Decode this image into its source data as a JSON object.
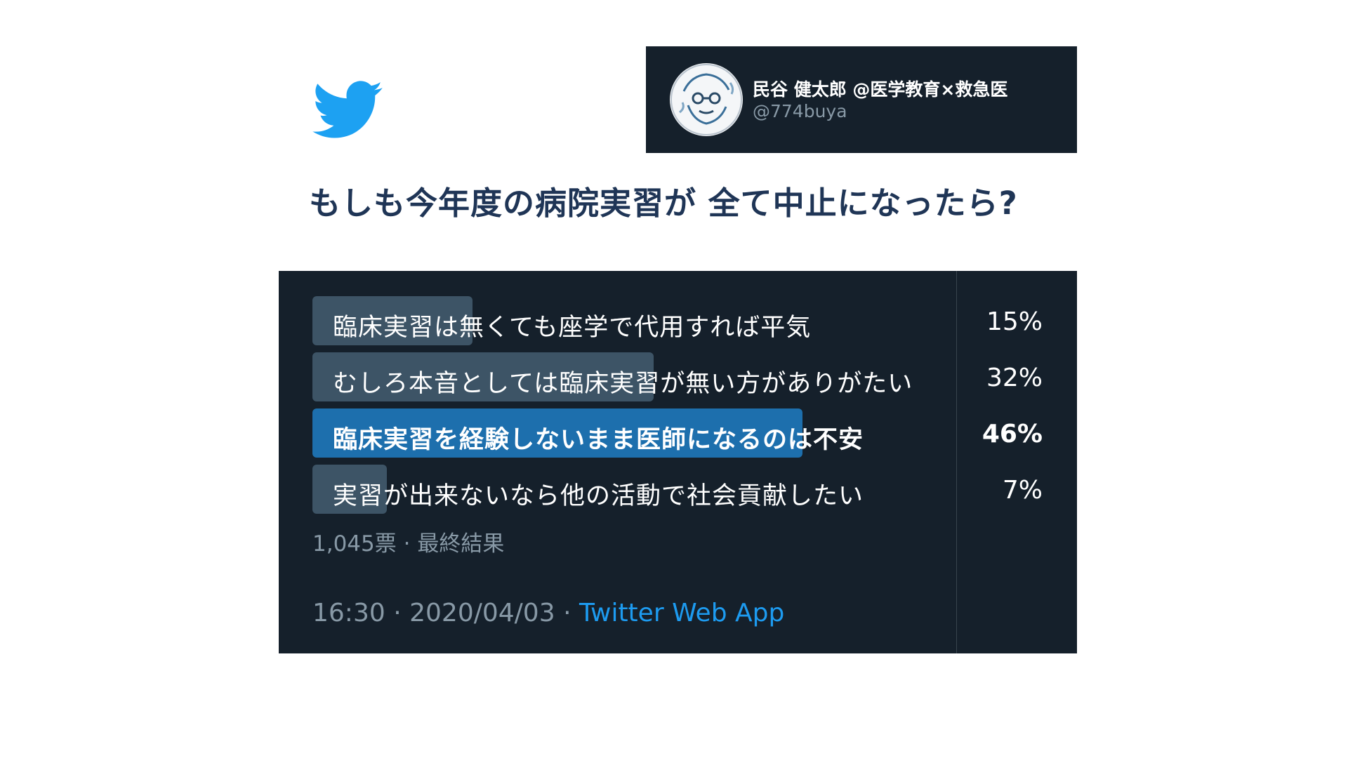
{
  "brand": {
    "logo_icon": "twitter-bird-icon",
    "logo_color": "#1da1f2"
  },
  "profile": {
    "display_name": "民谷 健太郎 @医学教育×救急医",
    "handle": "@774buya",
    "avatar_icon": "avatar-illustration-icon"
  },
  "headline": "もしも今年度の病院実習が 全て中止になったら?",
  "poll": {
    "options": [
      {
        "label": "臨床実習は無くても座学で代用すれば平気",
        "percent_label": "15%",
        "percent": 15,
        "winner": false
      },
      {
        "label": "むしろ本音としては臨床実習が無い方がありがたい",
        "percent_label": "32%",
        "percent": 32,
        "winner": false
      },
      {
        "label": "臨床実習を経験しないまま医師になるのは不安",
        "percent_label": "46%",
        "percent": 46,
        "winner": true
      },
      {
        "label": "実習が出来ないなら他の活動で社会貢献したい",
        "percent_label": "7%",
        "percent": 7,
        "winner": false
      }
    ],
    "votes": "1,045票",
    "separator": "·",
    "status": "最終結果"
  },
  "tweet_meta": {
    "time": "16:30",
    "date": "2020/04/03",
    "separator": "·",
    "source": "Twitter Web App"
  },
  "colors": {
    "panel_bg": "#15202b",
    "bar": "#3d5466",
    "winner_bar": "#1d6fad",
    "headline": "#1f3556",
    "link": "#1d9bf0",
    "muted": "#8899a6"
  }
}
